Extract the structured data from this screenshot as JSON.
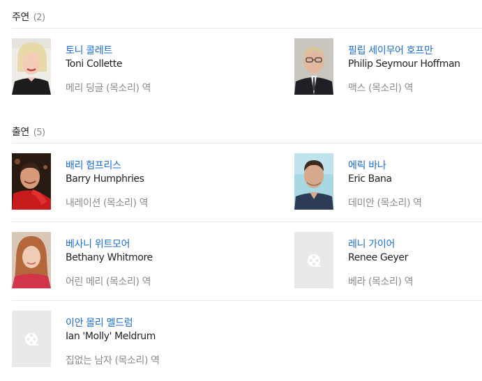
{
  "sections": {
    "lead": {
      "title": "주연",
      "count": "(2)"
    },
    "cast": {
      "title": "출연",
      "count": "(5)"
    }
  },
  "people": [
    {
      "name_ko": "토니 콜레트",
      "name_en": "Toni Collette",
      "role": "메리 딩글 (목소리) 역",
      "photo": "portrait-icon"
    },
    {
      "name_ko": "필립 세이무어 호프만",
      "name_en": "Philip Seymour Hoffman",
      "role": "맥스 (목소리) 역",
      "photo": "portrait-icon"
    },
    {
      "name_ko": "배리 험프리스",
      "name_en": "Barry Humphries",
      "role": "내레이션 (목소리) 역",
      "photo": "portrait-icon"
    },
    {
      "name_ko": "에릭 바나",
      "name_en": "Eric Bana",
      "role": "데미안 (목소리) 역",
      "photo": "portrait-icon"
    },
    {
      "name_ko": "베사니 위트모어",
      "name_en": "Bethany Whitmore",
      "role": "어린 메리 (목소리) 역",
      "photo": "portrait-icon"
    },
    {
      "name_ko": "레니 가이어",
      "name_en": "Renee Geyer",
      "role": "베라 (목소리) 역",
      "photo": "film-reel-icon"
    },
    {
      "name_ko": "이안 몰리 멜드럼",
      "name_en": "Ian 'Molly' Meldrum",
      "role": "집없는 남자 (목소리) 역",
      "photo": "film-reel-icon"
    }
  ],
  "colors": {
    "link": "#1a6dd6",
    "placeholder_bg": "#e9e9e9",
    "divider": "#e8e8e8"
  }
}
